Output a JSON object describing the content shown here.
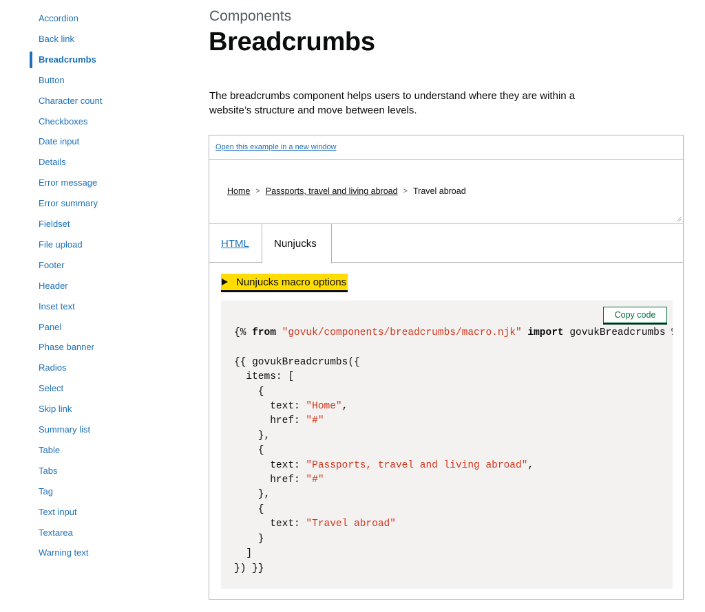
{
  "sidebar": {
    "active_index": 2,
    "items": [
      {
        "label": "Accordion"
      },
      {
        "label": "Back link"
      },
      {
        "label": "Breadcrumbs"
      },
      {
        "label": "Button"
      },
      {
        "label": "Character count"
      },
      {
        "label": "Checkboxes"
      },
      {
        "label": "Date input"
      },
      {
        "label": "Details"
      },
      {
        "label": "Error message"
      },
      {
        "label": "Error summary"
      },
      {
        "label": "Fieldset"
      },
      {
        "label": "File upload"
      },
      {
        "label": "Footer"
      },
      {
        "label": "Header"
      },
      {
        "label": "Inset text"
      },
      {
        "label": "Panel"
      },
      {
        "label": "Phase banner"
      },
      {
        "label": "Radios"
      },
      {
        "label": "Select"
      },
      {
        "label": "Skip link"
      },
      {
        "label": "Summary list"
      },
      {
        "label": "Table"
      },
      {
        "label": "Tabs"
      },
      {
        "label": "Tag"
      },
      {
        "label": "Text input"
      },
      {
        "label": "Textarea"
      },
      {
        "label": "Warning text"
      }
    ]
  },
  "main": {
    "caption": "Components",
    "title": "Breadcrumbs",
    "lead": "The breadcrumbs component helps users to understand where they are within a website’s structure and move between levels."
  },
  "example": {
    "open_link": "Open this example in a new window",
    "breadcrumbs": [
      {
        "text": "Home",
        "link": true
      },
      {
        "text": "Passports, travel and living abroad",
        "link": true
      },
      {
        "text": "Travel abroad",
        "link": false
      }
    ],
    "separator": ">",
    "tabs": [
      {
        "label": "HTML",
        "selected": false
      },
      {
        "label": "Nunjucks",
        "selected": true
      }
    ],
    "details_summary": "Nunjucks macro options",
    "copy_button": "Copy code",
    "code": {
      "import_open": "{% ",
      "from_kw": "from",
      "path": "\"govuk/components/breadcrumbs/macro.njk\"",
      "import_kw": "import",
      "import_rest": "govukBreadcrumbs %}",
      "lines": [
        {
          "pre": "{{ govukBreadcrumbs({",
          "str": "",
          "post": ""
        },
        {
          "pre": "  items: [",
          "str": "",
          "post": ""
        },
        {
          "pre": "    {",
          "str": "",
          "post": ""
        },
        {
          "pre": "      text: ",
          "str": "\"Home\"",
          "post": ","
        },
        {
          "pre": "      href: ",
          "str": "\"#\"",
          "post": ""
        },
        {
          "pre": "    },",
          "str": "",
          "post": ""
        },
        {
          "pre": "    {",
          "str": "",
          "post": ""
        },
        {
          "pre": "      text: ",
          "str": "\"Passports, travel and living abroad\"",
          "post": ","
        },
        {
          "pre": "      href: ",
          "str": "\"#\"",
          "post": ""
        },
        {
          "pre": "    },",
          "str": "",
          "post": ""
        },
        {
          "pre": "    {",
          "str": "",
          "post": ""
        },
        {
          "pre": "      text: ",
          "str": "\"Travel abroad\"",
          "post": ""
        },
        {
          "pre": "    }",
          "str": "",
          "post": ""
        },
        {
          "pre": "  ]",
          "str": "",
          "post": ""
        },
        {
          "pre": "}) }}",
          "str": "",
          "post": ""
        }
      ]
    }
  },
  "colors": {
    "link": "#1d70b8",
    "text": "#0b0c0c",
    "secondary_text": "#505a5f",
    "focus_yellow": "#ffdd00",
    "green": "#00703c",
    "code_string": "#d4351c",
    "code_bg": "#f3f2f1",
    "border": "#b1b4b6"
  }
}
